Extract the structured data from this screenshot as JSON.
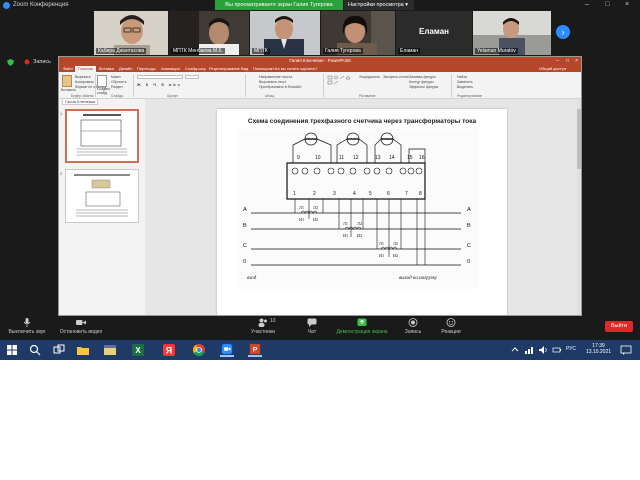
{
  "zoom": {
    "window_title": "Zoom Конференция",
    "share_banner": "Вы просматриваете экран Галия Тугерова",
    "view_options": "Настройки просмотра ▾",
    "win_controls": [
      "–",
      "□",
      "×"
    ]
  },
  "participants": [
    {
      "name": "Кабира Джантасова"
    },
    {
      "name": "МПТК Менбаева М.К."
    },
    {
      "name": "МПТК"
    },
    {
      "name": "Галия Тугерова"
    },
    {
      "name": "Еламан",
      "label_big": "Еламан"
    },
    {
      "name": "Yelaman Muratov"
    }
  ],
  "recording": {
    "label": "Запись"
  },
  "ppt": {
    "title": "Галия Ключевая - PowerPoint",
    "tabs": [
      "Файл",
      "Главная",
      "Вставка",
      "Дизайн",
      "Переходы",
      "Анимация",
      "Слайд-шоу",
      "Рецензирование",
      "Вид",
      "Помощник",
      "Что вы хотите сделать?"
    ],
    "active_tab_index": 1,
    "share_label": "Общий доступ",
    "ribbon": {
      "paste": "Вставить",
      "cut": "Вырезать",
      "copy": "Копировать",
      "format_painter": "Формат по образцу",
      "new_slide": "Создать слайд",
      "layout": "Макет",
      "reset": "Сбросить",
      "section": "Раздел",
      "groups": [
        "Буфер обмена",
        "Слайды",
        "Шрифт",
        "Абзац",
        "Рисование",
        "Редактирование"
      ],
      "find": "Найти",
      "replace": "Заменить",
      "select": "Выделить",
      "arrange": "Упорядочить",
      "quick_styles": "Экспресс-стили",
      "fill": "Заливка фигуры",
      "outline": "Контур фигуры",
      "effects": "Эффекты фигуры",
      "text_dir": "Направление текста",
      "align_text": "Выровнять текст",
      "smartart": "Преобразовать в SmartArt"
    },
    "thumbnail_pane_title": "Галия Ключевая",
    "slide_numbers": [
      "1",
      "2"
    ],
    "slide_title": "Схема соединения трехфазного счетчика через трансформаторы тока",
    "diagram": {
      "terminals": [
        "1",
        "2",
        "3",
        "4",
        "5",
        "6",
        "7",
        "8"
      ],
      "top_terminals": [
        "9",
        "10",
        "11",
        "12",
        "13",
        "14",
        "15",
        "16"
      ],
      "phase_labels": [
        "A",
        "B",
        "C",
        "0"
      ],
      "ct_labels": [
        "Л1",
        "Л2",
        "И1",
        "И2"
      ],
      "input_label": "вход",
      "output_label": "выход на нагрузку"
    }
  },
  "controls": {
    "mute": "Выключить звук",
    "video": "Остановить видео",
    "participants": "Участники",
    "participants_count": "10",
    "chat": "Чат",
    "share": "Демонстрация экрана",
    "record": "Запись",
    "reactions": "Реакции",
    "leave": "Выйти"
  },
  "taskbar": {
    "lang": "РУС",
    "time": "17:39",
    "date": "13.10.2021",
    "apps": [
      "start-icon",
      "search-icon",
      "task-view-icon",
      "file-explorer-icon",
      "excel-icon",
      "yandex-icon",
      "chrome-icon",
      "zoom-icon",
      "powerpoint-icon"
    ]
  },
  "colors": {
    "zoom_bg": "#1a1a1a",
    "share_green": "#2aa13a",
    "ppt_red": "#b7472a",
    "leave_red": "#e02828",
    "taskbar": "#1f3a66",
    "zoom_blue": "#2d8cff"
  }
}
